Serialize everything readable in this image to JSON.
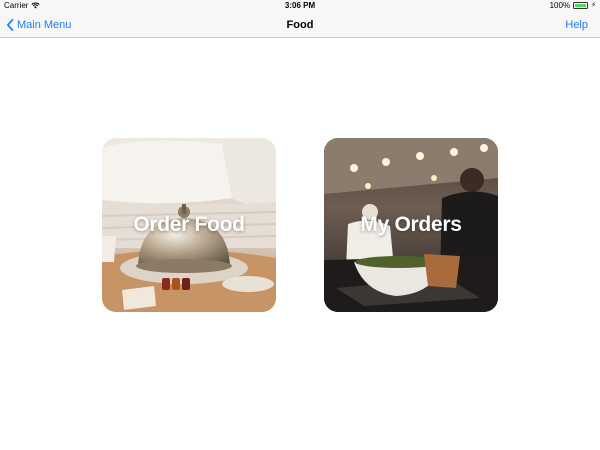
{
  "status_bar": {
    "carrier": "Carrier",
    "time": "3:06 PM",
    "battery": "100%",
    "battery_level": 1.0
  },
  "nav_bar": {
    "back_label": "Main Menu",
    "title": "Food",
    "help_label": "Help",
    "tint_color": "#1f7cf1"
  },
  "tiles": [
    {
      "label": "Order Food",
      "image": "room-service-cloche-photo"
    },
    {
      "label": "My Orders",
      "image": "restaurant-kitchen-chef-photo"
    }
  ]
}
